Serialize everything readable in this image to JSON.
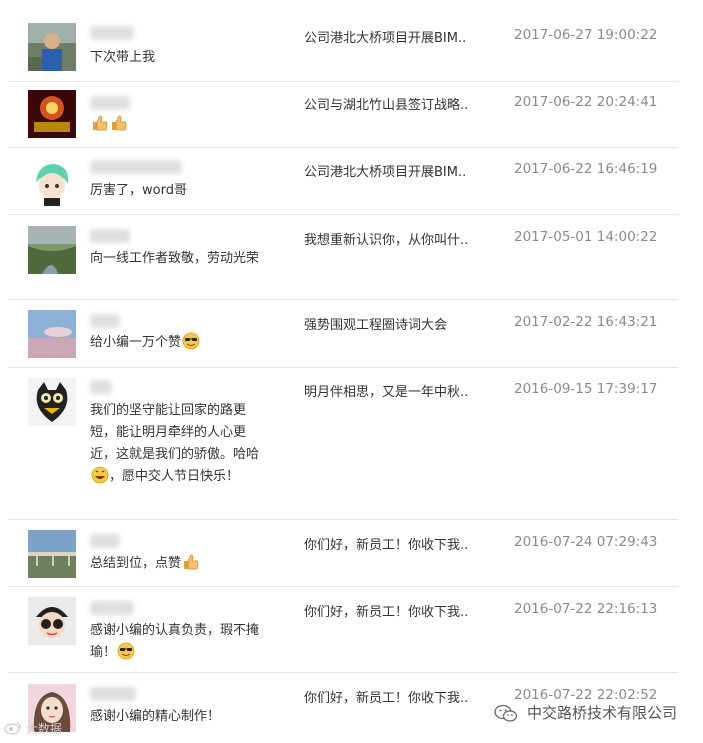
{
  "comments": [
    {
      "text": "下次带上我",
      "emoji": "",
      "article": "公司港北大桥项目开展BIM..",
      "time": "2017-06-27 19:00:22",
      "avatar": "photo-person-avatar"
    },
    {
      "text": "",
      "emoji": "thumbs-up-thumbs-up",
      "article": "公司与湖北竹山县签订战略..",
      "time": "2017-06-22 20:24:41",
      "avatar": "photo-red-lights-avatar"
    },
    {
      "text": "厉害了，word哥",
      "emoji": "",
      "article": "公司港北大桥项目开展BIM..",
      "time": "2017-06-22 16:46:19",
      "avatar": "cartoon-green-hair-avatar"
    },
    {
      "text": "向一线工作者致敬，劳动光荣",
      "emoji": "",
      "article": "我想重新认识你，从你叫什..",
      "time": "2017-05-01 14:00:22",
      "avatar": "photo-river-avatar"
    },
    {
      "text": "给小编一万个赞",
      "emoji": "sunglasses",
      "article": "强势围观工程圈诗词大会",
      "time": "2017-02-22 16:43:21",
      "avatar": "photo-sky-avatar"
    },
    {
      "text_a": "我们的坚守能让回家的路更短，能让明月牵绊的人心更近，这就是我们的骄傲。哈哈",
      "text_b": "，愿中交人节日快乐！",
      "emoji": "grin",
      "article": "明月伴相思，又是一年中秋..",
      "time": "2016-09-15 17:39:17",
      "avatar": "cartoon-owl-avatar"
    },
    {
      "text": "总结到位，点赞",
      "emoji": "thumbs-up",
      "article": "你们好，新员工！你收下我..",
      "time": "2016-07-24 07:29:43",
      "avatar": "photo-bridge-avatar"
    },
    {
      "text": "感谢小编的认真负责，瑕不掩瑜！",
      "emoji": "sunglasses",
      "article": "你们好，新员工！你收下我..",
      "time": "2016-07-22 22:16:13",
      "avatar": "cartoon-glasses-avatar"
    },
    {
      "text": "感谢小编的精心制作！",
      "emoji": "",
      "article": "你们好，新员工！你收下我..",
      "time": "2016-07-22 22:02:52",
      "avatar": "photo-girl-avatar"
    }
  ],
  "watermarks": {
    "left": "大数据",
    "right": "中交路桥技术有限公司"
  },
  "colors": {
    "time": "#8a8a8a",
    "divider": "#e6e6e6",
    "text": "#333333"
  }
}
